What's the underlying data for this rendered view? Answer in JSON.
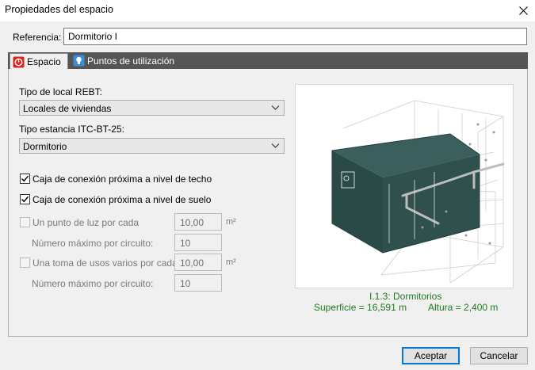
{
  "window": {
    "title": "Propiedades del espacio"
  },
  "referencia": {
    "label": "Referencia:",
    "value": "Dormitorio I"
  },
  "tabs": [
    {
      "label": "Espacio",
      "active": true,
      "icon": "espacio-red-icon"
    },
    {
      "label": "Puntos de utilización",
      "active": false,
      "icon": "lightbulb-icon"
    }
  ],
  "espacio": {
    "tipo_local_label": "Tipo de local REBT:",
    "tipo_local_value": "Locales de viviendas",
    "tipo_estancia_label": "Tipo estancia ITC-BT-25:",
    "tipo_estancia_value": "Dormitorio",
    "caja_techo_label": "Caja de conexión próxima a nivel de techo",
    "caja_techo_checked": true,
    "caja_suelo_label": "Caja de conexión próxima a nivel de suelo",
    "caja_suelo_checked": true,
    "punto_luz_label": "Un punto de luz por cada",
    "punto_luz_value": "10,00",
    "punto_luz_unit": "m²",
    "max_circuito_label_1": "Número máximo por circuito:",
    "max_circuito_value_1": "10",
    "toma_label": "Una toma de usos varios por cada",
    "toma_value": "10,00",
    "toma_unit": "m²",
    "max_circuito_label_2": "Número máximo por circuito:",
    "max_circuito_value_2": "10"
  },
  "preview": {
    "caption": "I.1.3: Dormitorios",
    "superficie": "Superficie = 16,591 m",
    "altura": "Altura = 2,400 m",
    "room_color": "#2a4a48"
  },
  "buttons": {
    "accept": "Aceptar",
    "cancel": "Cancelar"
  },
  "colors": {
    "accent": "#0078d7",
    "tabbar": "#555555",
    "caption": "#1f7a1f"
  }
}
